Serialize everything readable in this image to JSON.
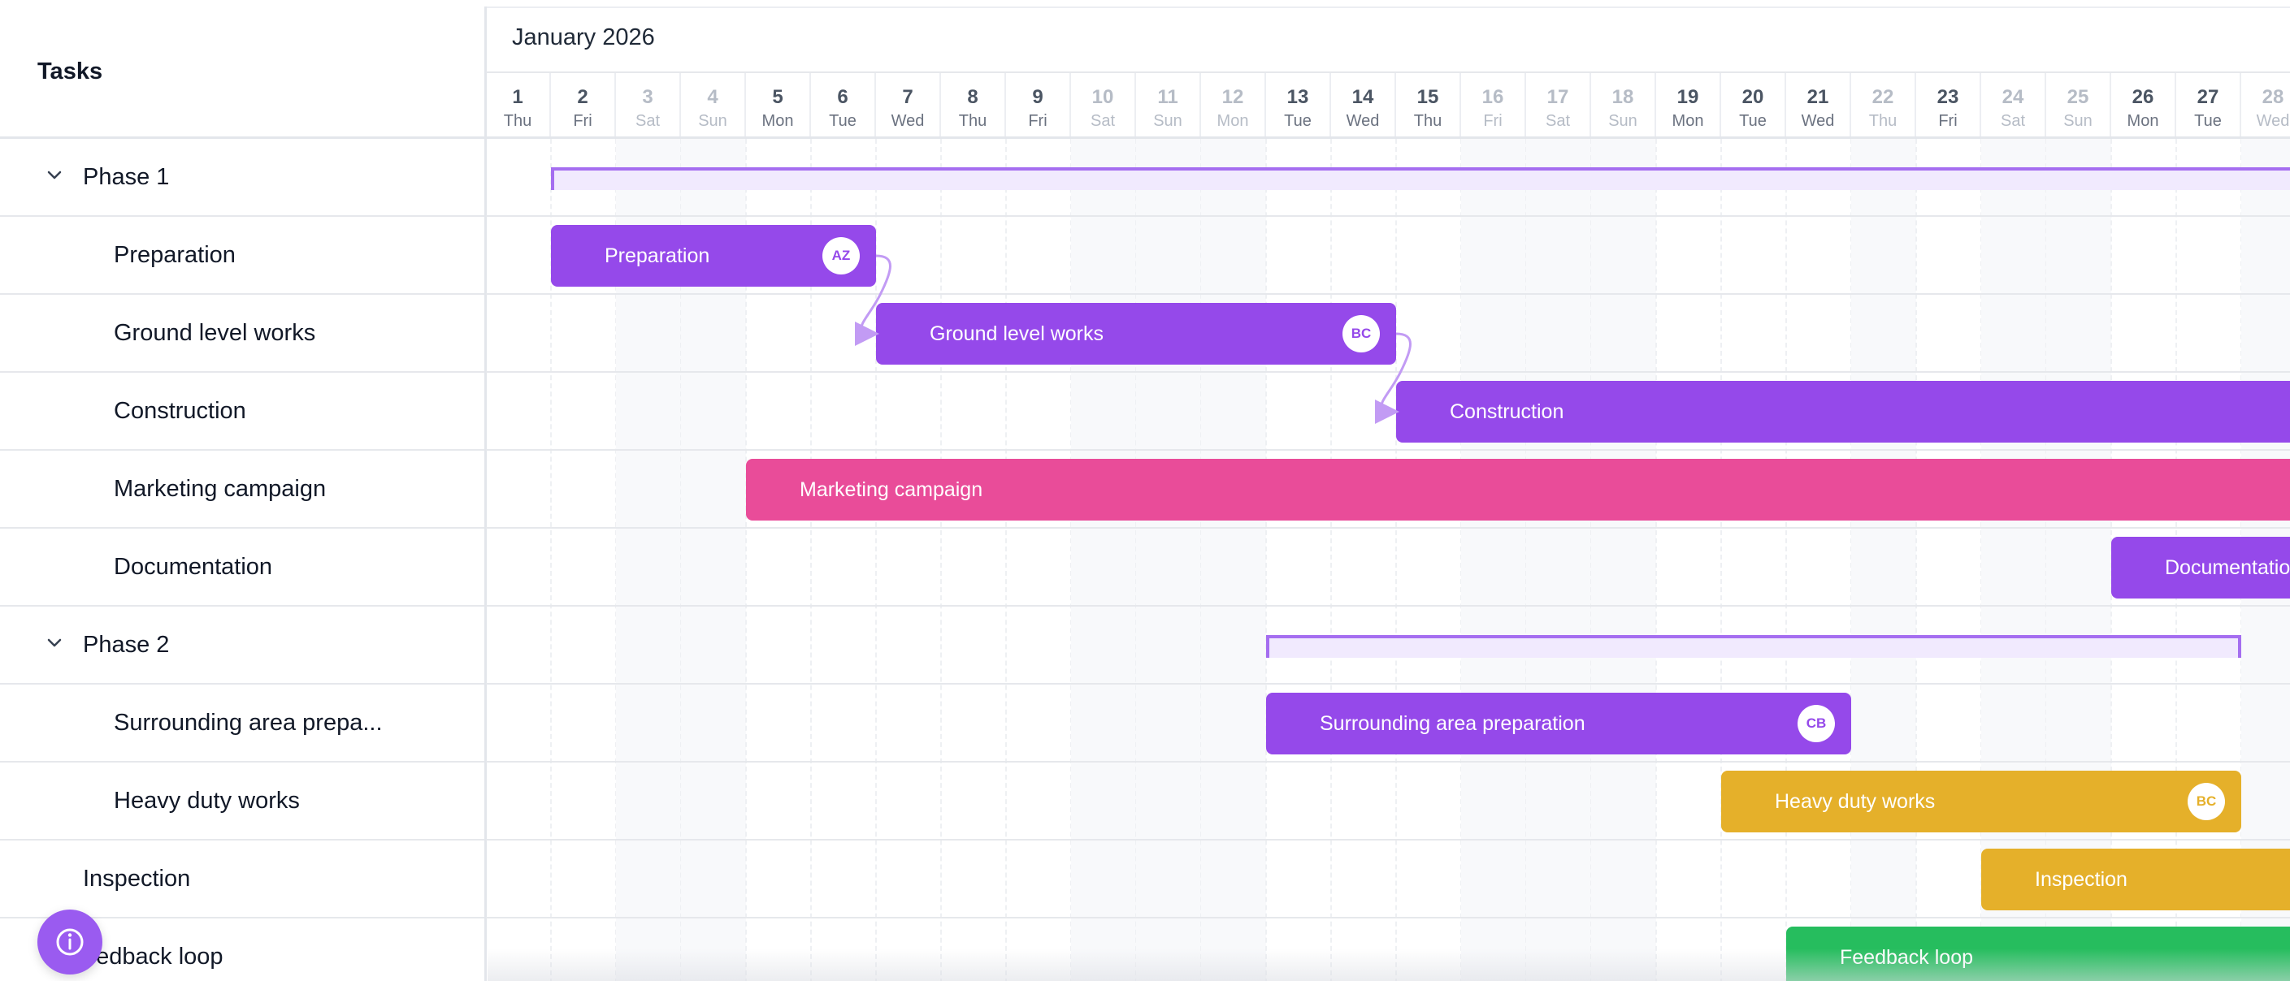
{
  "header": {
    "tasks_label": "Tasks",
    "month_label": "January 2026"
  },
  "days": [
    {
      "num": "1",
      "wd": "Thu",
      "weekend": false
    },
    {
      "num": "2",
      "wd": "Fri",
      "weekend": false
    },
    {
      "num": "3",
      "wd": "Sat",
      "weekend": true
    },
    {
      "num": "4",
      "wd": "Sun",
      "weekend": true
    },
    {
      "num": "5",
      "wd": "Mon",
      "weekend": false
    },
    {
      "num": "6",
      "wd": "Tue",
      "weekend": false
    },
    {
      "num": "7",
      "wd": "Wed",
      "weekend": false
    },
    {
      "num": "8",
      "wd": "Thu",
      "weekend": false
    },
    {
      "num": "9",
      "wd": "Fri",
      "weekend": false
    },
    {
      "num": "10",
      "wd": "Sat",
      "weekend": true
    },
    {
      "num": "11",
      "wd": "Sun",
      "weekend": true
    },
    {
      "num": "12",
      "wd": "Mon",
      "weekend": true
    },
    {
      "num": "13",
      "wd": "Tue",
      "weekend": false
    },
    {
      "num": "14",
      "wd": "Wed",
      "weekend": false
    },
    {
      "num": "15",
      "wd": "Thu",
      "weekend": false
    },
    {
      "num": "16",
      "wd": "Fri",
      "weekend": true
    },
    {
      "num": "17",
      "wd": "Sat",
      "weekend": true
    },
    {
      "num": "18",
      "wd": "Sun",
      "weekend": true
    },
    {
      "num": "19",
      "wd": "Mon",
      "weekend": false
    },
    {
      "num": "20",
      "wd": "Tue",
      "weekend": false
    },
    {
      "num": "21",
      "wd": "Wed",
      "weekend": false
    },
    {
      "num": "22",
      "wd": "Thu",
      "weekend": true
    },
    {
      "num": "23",
      "wd": "Fri",
      "weekend": false
    },
    {
      "num": "24",
      "wd": "Sat",
      "weekend": true
    },
    {
      "num": "25",
      "wd": "Sun",
      "weekend": true
    },
    {
      "num": "26",
      "wd": "Mon",
      "weekend": false
    },
    {
      "num": "27",
      "wd": "Tue",
      "weekend": false
    },
    {
      "num": "28",
      "wd": "Wed",
      "weekend": true
    }
  ],
  "rows": [
    {
      "label": "Phase 1",
      "kind": "phase",
      "chevron": "chevron-down-icon"
    },
    {
      "label": "Preparation",
      "kind": "task"
    },
    {
      "label": "Ground level works",
      "kind": "task"
    },
    {
      "label": "Construction",
      "kind": "task"
    },
    {
      "label": "Marketing campaign",
      "kind": "task"
    },
    {
      "label": "Documentation",
      "kind": "task"
    },
    {
      "label": "Phase 2",
      "kind": "phase",
      "chevron": "chevron-down-icon"
    },
    {
      "label": "Surrounding area prepa...",
      "kind": "task"
    },
    {
      "label": "Heavy duty works",
      "kind": "task"
    },
    {
      "label": "Inspection",
      "kind": "top"
    },
    {
      "label": "eedback loop",
      "kind": "top"
    }
  ],
  "bars": [
    {
      "row": 1,
      "start": 1,
      "end": 6,
      "label": "Preparation",
      "color": "#9549ea",
      "avatar": "AZ"
    },
    {
      "row": 2,
      "start": 6,
      "end": 14,
      "label": "Ground level works",
      "color": "#9549ea",
      "avatar": "BC"
    },
    {
      "row": 3,
      "start": 14,
      "end": 30,
      "label": "Construction",
      "color": "#9549ea",
      "avatar": ""
    },
    {
      "row": 4,
      "start": 4,
      "end": 30,
      "label": "Marketing campaign",
      "color": "#e94c99",
      "avatar": ""
    },
    {
      "row": 5,
      "start": 25,
      "end": 30,
      "label": "Documentatio",
      "color": "#9549ea",
      "avatar": ""
    },
    {
      "row": 7,
      "start": 12,
      "end": 21,
      "label": "Surrounding area preparation",
      "color": "#9549ea",
      "avatar": "CB"
    },
    {
      "row": 8,
      "start": 19,
      "end": 27,
      "label": "Heavy duty works",
      "color": "#e5b02a",
      "avatar": "BC"
    },
    {
      "row": 9,
      "start": 23,
      "end": 30,
      "label": "Inspection",
      "color": "#e5b02a",
      "avatar": ""
    },
    {
      "row": 10,
      "start": 20,
      "end": 30,
      "label": "Feedback loop",
      "color": "#26bd5e",
      "avatar": ""
    }
  ],
  "phases": [
    {
      "row": 0,
      "start": 1,
      "end": 30,
      "label": "Phase 1"
    },
    {
      "row": 6,
      "start": 12,
      "end": 27,
      "label": "Phase 2"
    }
  ],
  "links": [
    {
      "from_row": 1,
      "to_row": 2,
      "at_day": 6
    },
    {
      "from_row": 2,
      "to_row": 3,
      "at_day": 14
    }
  ],
  "colors": {
    "accent": "#9549ea",
    "link": "#c29bf4",
    "fab": "#9a5bf0"
  },
  "fab": {
    "icon": "info-icon"
  }
}
